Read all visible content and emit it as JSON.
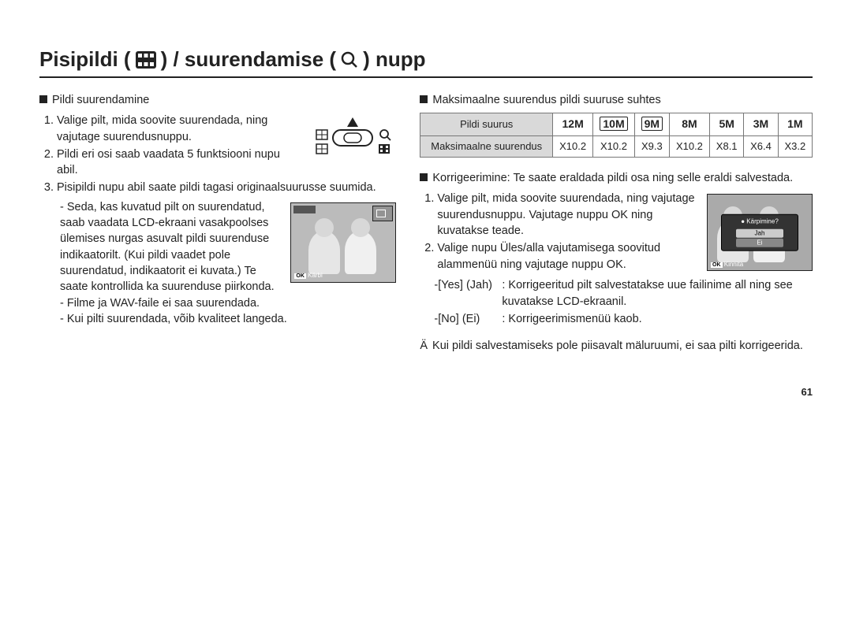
{
  "heading": {
    "part1": "Pisipildi (",
    "part2": ") / suurendamise (",
    "part3": ") nupp",
    "thumb_icon_name": "thumbnail-grid-icon",
    "mag_icon_name": "magnifier-icon"
  },
  "left": {
    "section_title": "Pildi suurendamine",
    "step1": "Valige pilt, mida soovite suurendada, ning vajutage suurendusnuppu.",
    "step2": "Pildi eri osi saab vaadata 5 funktsiooni nupu abil.",
    "step3": "Pisipildi nupu abil saate pildi tagasi originaalsuurusse suumida.",
    "sub_a": "Seda, kas kuvatud pilt on suurendatud, saab vaadata LCD-ekraani vasakpoolses ülemises nurgas asuvalt pildi suurenduse indikaatorilt. (Kui pildi vaadet pole suurendatud, indikaatorit ei kuvata.) Te saate kontrollida ka suurenduse piirkonda.",
    "sub_b": "Filme ja WAV-faile ei saa suurendada.",
    "sub_c": "Kui pilti suurendada, võib kvaliteet langeda.",
    "zoom_indicator_label": "x 1.1",
    "ok_crop_label": "Kärbi"
  },
  "right": {
    "table_title": "Maksimaalne suurendus pildi suuruse suhtes",
    "table": {
      "row1_header": "Pildi suurus",
      "row2_header": "Maksimaalne suurendus",
      "sizes": [
        "12M",
        "10M",
        "9M",
        "8M",
        "5M",
        "3M",
        "1M"
      ],
      "zoom": [
        "X10.2",
        "X10.2",
        "X9.3",
        "X10.2",
        "X8.1",
        "X6.4",
        "X3.2"
      ]
    },
    "crop_title": "Korrigeerimine: Te saate eraldada pildi osa ning selle eraldi salvestada.",
    "crop_step1": "Valige pilt, mida soovite suurendada, ning vajutage suurendusnuppu. Vajutage nuppu OK ning kuvatakse teade.",
    "crop_step2": "Valige nupu Üles/alla vajutamisega soovitud alammenüü ning vajutage nuppu OK.",
    "yes_label": "-[Yes] (Jah)",
    "yes_text": ": Korrigeeritud pilt salvestatakse uue failinime all ning see kuvatakse LCD-ekraanil.",
    "no_label": "-[No] (Ei)",
    "no_text": ": Korrigeerimismenüü kaob.",
    "dialog": {
      "title": "Kärpimine?",
      "yes": "Jah",
      "no": "Ei",
      "confirm": "Kinnita"
    },
    "note": "Kui pildi salvestamiseks pole piisavalt mäluruumi, ei saa pilti korrigeerida."
  },
  "page_number": "61",
  "chart_data": {
    "type": "table",
    "title": "Maksimaalne suurendus pildi suuruse suhtes",
    "categories": [
      "12M",
      "10M",
      "9M",
      "8M",
      "5M",
      "3M",
      "1M"
    ],
    "values": [
      10.2,
      10.2,
      9.3,
      10.2,
      8.1,
      6.4,
      3.2
    ],
    "xlabel": "Pildi suurus",
    "ylabel": "Maksimaalne suurendus"
  }
}
